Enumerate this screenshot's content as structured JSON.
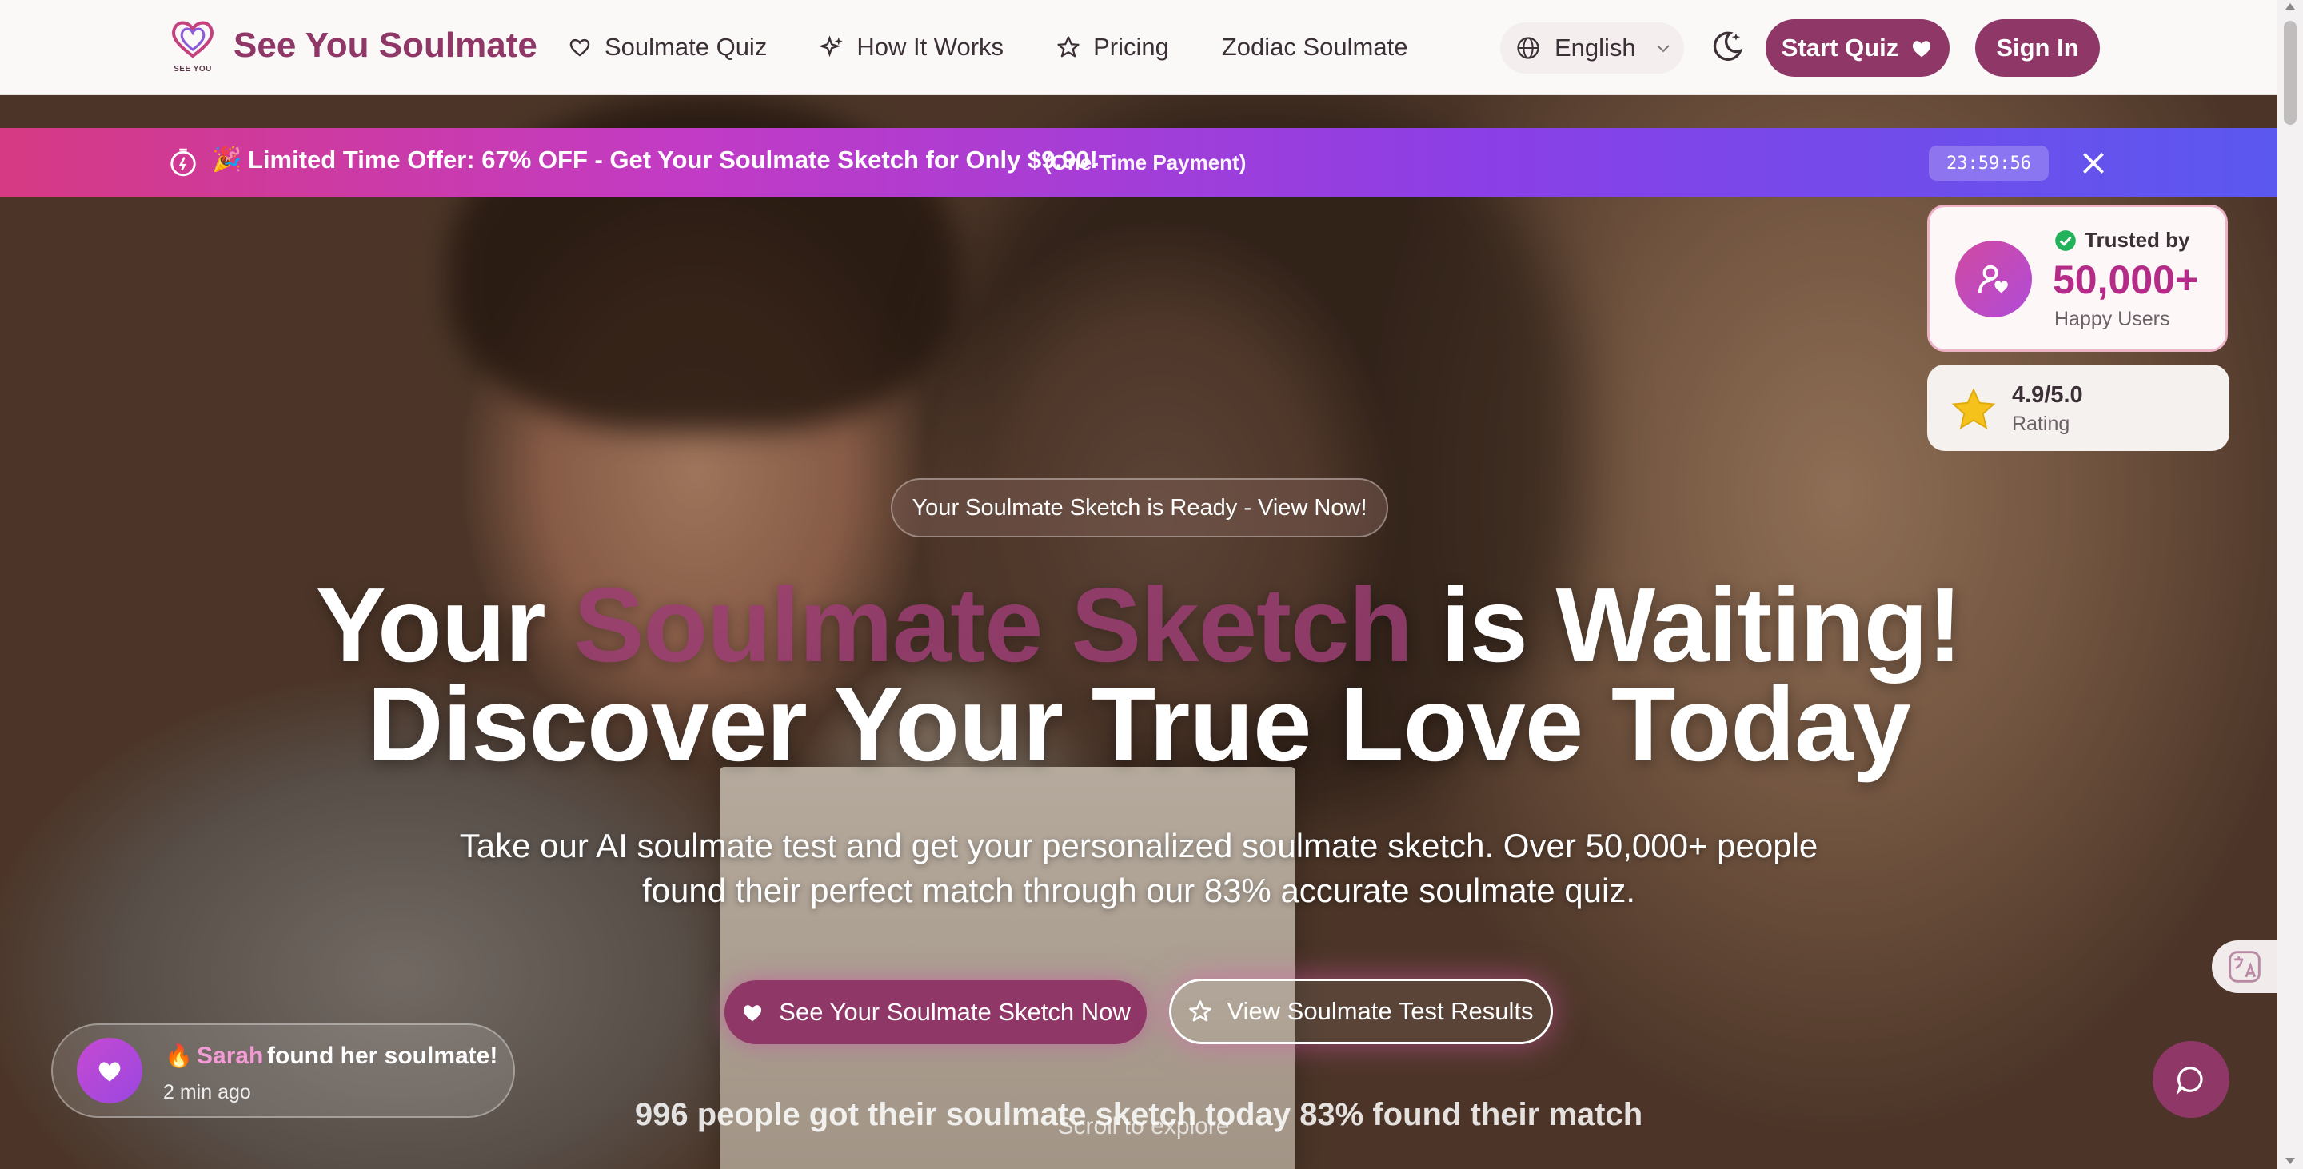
{
  "header": {
    "brand": "See You Soulmate",
    "logo_sub": "SEE YOU",
    "nav": [
      {
        "label": "Soulmate Quiz",
        "icon": "heart-icon"
      },
      {
        "label": "How It Works",
        "icon": "sparkles-icon"
      },
      {
        "label": "Pricing",
        "icon": "star-icon"
      },
      {
        "label": "Zodiac Soulmate",
        "icon": ""
      }
    ],
    "language": "English",
    "start_quiz": "Start Quiz",
    "sign_in": "Sign In"
  },
  "promo": {
    "emoji": "🎉",
    "text": "Limited Time Offer: 67% OFF - Get Your Soulmate Sketch for Only $9.90!",
    "sub": "(One-Time Payment)",
    "countdown": "23:59:56"
  },
  "trust": {
    "label": "Trusted by",
    "count": "50,000+",
    "caption": "Happy Users",
    "rating": "4.9/5.0",
    "rating_label": "Rating"
  },
  "hero": {
    "ready_pill": "Your Soulmate Sketch is Ready - View Now!",
    "headline_pre": "Your ",
    "headline_highlight": "Soulmate Sketch",
    "headline_post": " is Waiting!",
    "headline_line2": "Discover Your True Love Today",
    "subcopy": "Take our AI soulmate test and get your personalized soulmate sketch. Over 50,000+ people found their perfect match through our 83% accurate soulmate quiz.",
    "cta_primary": "See Your Soulmate Sketch Now",
    "cta_secondary": "View Soulmate Test Results",
    "stats": "996 people got their soulmate sketch today 83% found their match",
    "scroll_hint": "Scroll to explore"
  },
  "toast": {
    "emoji": "🔥",
    "name": "Sarah",
    "message": "found her soulmate!",
    "time": "2 min ago"
  },
  "colors": {
    "brand": "#8f3767",
    "promo_start": "#d63a83",
    "promo_end": "#5a58ef",
    "accent_pink": "#b42b88"
  }
}
